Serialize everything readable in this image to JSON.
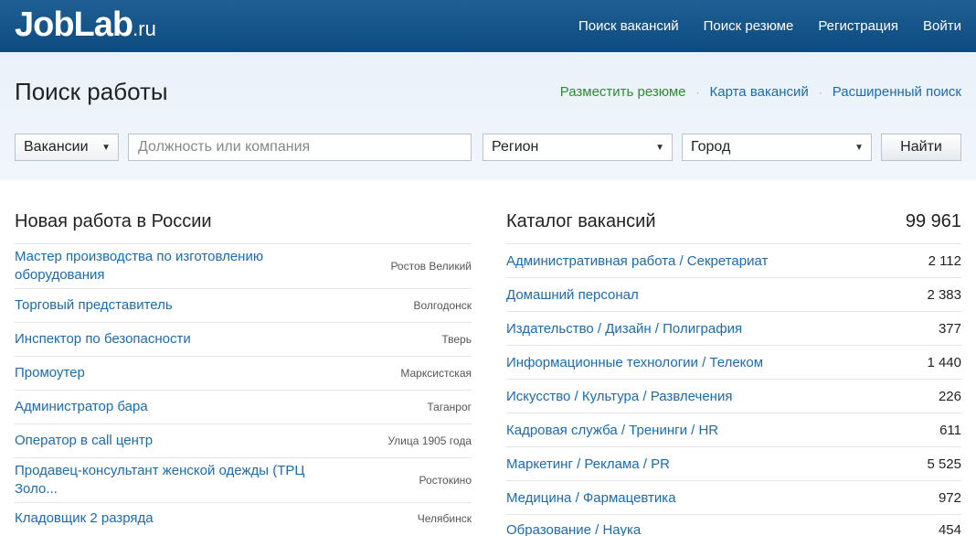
{
  "header": {
    "logo_main": "JobLab",
    "logo_tld": ".ru",
    "nav": [
      "Поиск вакансий",
      "Поиск резюме",
      "Регистрация",
      "Войти"
    ]
  },
  "band": {
    "title": "Поиск работы",
    "links": {
      "post_resume": "Разместить резюме",
      "separator": "·",
      "vacancy_map": "Карта вакансий",
      "advanced_search": "Расширенный поиск"
    }
  },
  "search": {
    "type_value": "Вакансии",
    "query_placeholder": "Должность или компания",
    "region_value": "Регион",
    "city_value": "Город",
    "submit_label": "Найти"
  },
  "new_jobs": {
    "title": "Новая работа в России",
    "items": [
      {
        "title": "Мастер производства по изготовлению оборудования",
        "city": "Ростов Великий"
      },
      {
        "title": "Торговый представитель",
        "city": "Волгодонск"
      },
      {
        "title": "Инспектор по безопасности",
        "city": "Тверь"
      },
      {
        "title": "Промоутер",
        "city": "Марксистская"
      },
      {
        "title": "Администратор бара",
        "city": "Таганрог"
      },
      {
        "title": "Оператор в call центр",
        "city": "Улица 1905 года"
      },
      {
        "title": "Продавец-консультант женской одежды (ТРЦ Золо...",
        "city": "Ростокино"
      },
      {
        "title": "Кладовщик 2 разряда",
        "city": "Челябинск"
      }
    ]
  },
  "catalog": {
    "title": "Каталог вакансий",
    "total": "99 961",
    "items": [
      {
        "name": "Административная работа / Секретариат",
        "count": "2 112"
      },
      {
        "name": "Домашний персонал",
        "count": "2 383"
      },
      {
        "name": "Издательство / Дизайн / Полиграфия",
        "count": "377"
      },
      {
        "name": "Информационные технологии / Телеком",
        "count": "1 440"
      },
      {
        "name": "Искусство / Культура / Развлечения",
        "count": "226"
      },
      {
        "name": "Кадровая служба / Тренинги / HR",
        "count": "611"
      },
      {
        "name": "Маркетинг / Реклама / PR",
        "count": "5 525"
      },
      {
        "name": "Медицина / Фармацевтика",
        "count": "972"
      },
      {
        "name": "Образование / Наука",
        "count": "454"
      }
    ]
  }
}
